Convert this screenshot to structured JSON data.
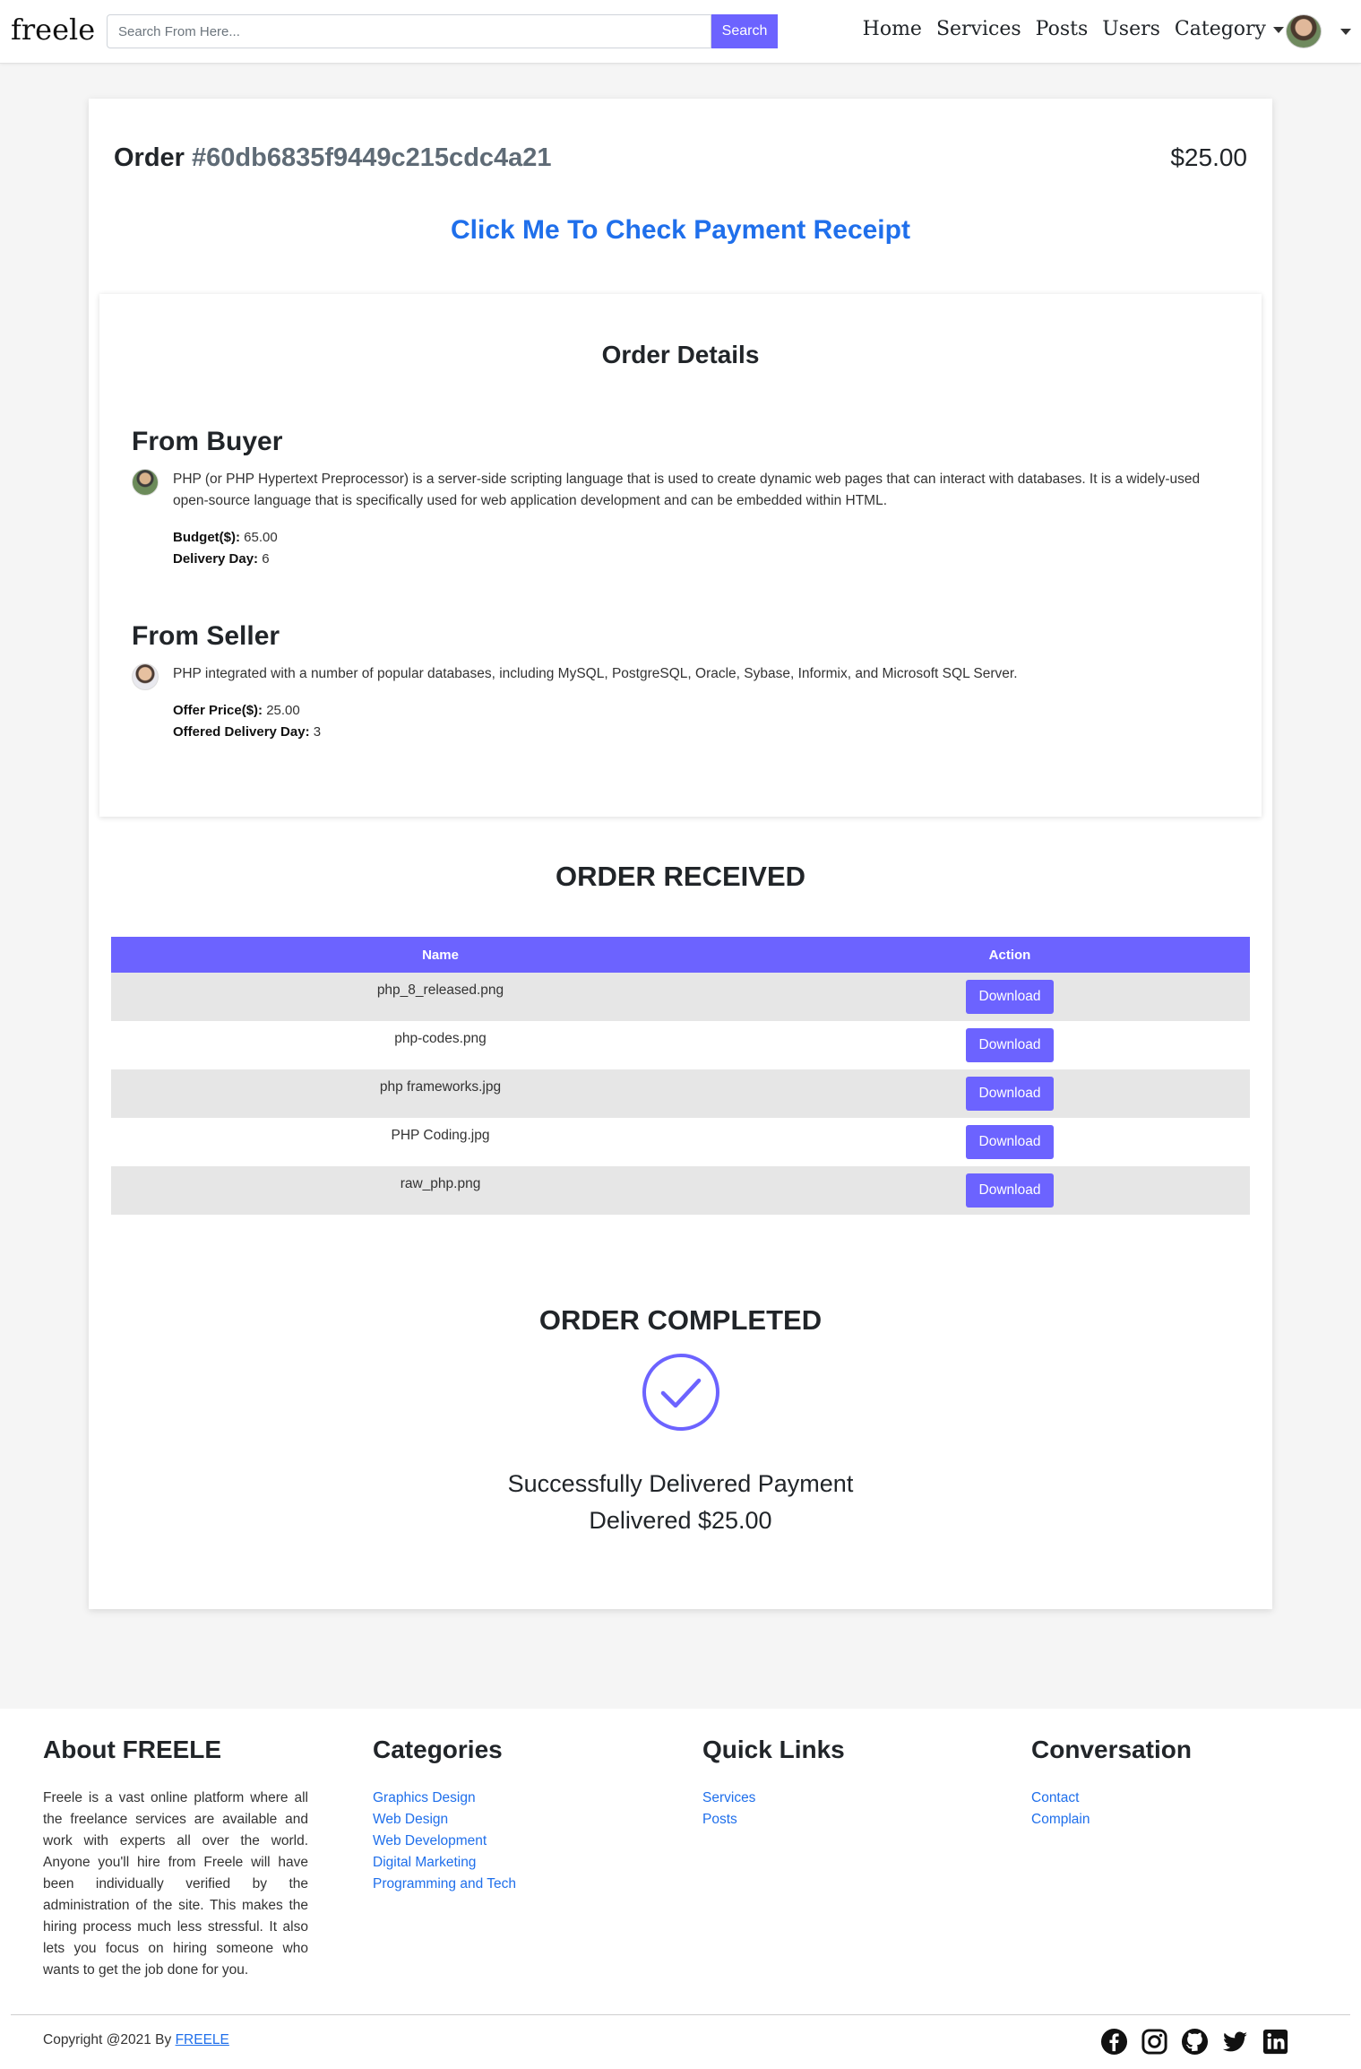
{
  "nav": {
    "brand": "freele",
    "search_placeholder": "Search From Here...",
    "search_button": "Search",
    "links": [
      "Home",
      "Services",
      "Posts",
      "Users",
      "Category"
    ]
  },
  "order": {
    "label": "Order",
    "id": "#60db6835f9449c215cdc4a21",
    "price": "$25.00",
    "receipt_link": "Click Me To Check Payment Receipt"
  },
  "details": {
    "title": "Order Details",
    "buyer": {
      "heading": "From Buyer",
      "message": "PHP (or PHP Hypertext Preprocessor) is a server-side scripting language that is used to create dynamic web pages that can interact with databases. It is a widely-used open-source language that is specifically used for web application development and can be embedded within HTML.",
      "budget_label": "Budget($):",
      "budget": "65.00",
      "delivery_label": "Delivery Day:",
      "delivery": "6"
    },
    "seller": {
      "heading": "From Seller",
      "message": "PHP integrated with a number of popular databases, including MySQL, PostgreSQL, Oracle, Sybase, Informix, and Microsoft SQL Server.",
      "offer_label": "Offer Price($):",
      "offer": "25.00",
      "delivery_label": "Offered Delivery Day:",
      "delivery": "3"
    }
  },
  "received": {
    "title": "ORDER RECEIVED",
    "columns": [
      "Name",
      "Action"
    ],
    "files": [
      "php_8_released.png",
      "php-codes.png",
      "php frameworks.jpg",
      "PHP Coding.jpg",
      "raw_php.png"
    ],
    "action_label": "Download"
  },
  "completed": {
    "title": "ORDER COMPLETED",
    "line1": "Successfully Delivered Payment",
    "line2": "Delivered $25.00"
  },
  "footer": {
    "about_title": "About FREELE",
    "about_text": "Freele is a vast online platform where all the freelance services are available and work with experts all over the world. Anyone you'll hire from Freele will have been individually verified by the administration of the site. This makes the hiring process much less stressful. It also lets you focus on hiring someone who wants to get the job done for you.",
    "categories_title": "Categories",
    "categories": [
      "Graphics Design",
      "Web Design",
      "Web Development",
      "Digital Marketing",
      "Programming and Tech"
    ],
    "quick_title": "Quick Links",
    "quick_links": [
      "Services",
      "Posts"
    ],
    "conv_title": "Conversation",
    "conv_links": [
      "Contact",
      "Complain"
    ],
    "copyright": "Copyright @2021 By",
    "copyright_link": "FREELE",
    "social": [
      "facebook-icon",
      "instagram-icon",
      "github-icon",
      "twitter-icon",
      "linkedin-icon"
    ]
  },
  "colors": {
    "accent": "#6c63ff",
    "link": "#1f6feb",
    "stripe": "#e6e6e6"
  }
}
